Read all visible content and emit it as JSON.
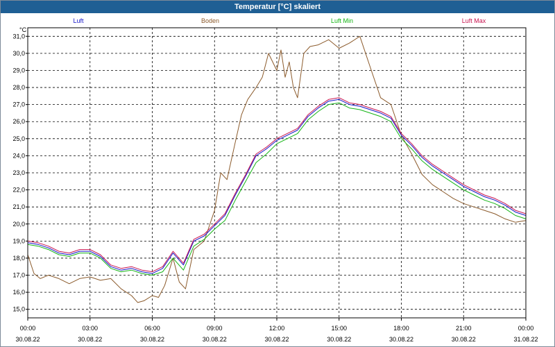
{
  "window": {
    "title": "Temperatur [°C] skaliert"
  },
  "colors": {
    "grid": "#000000",
    "frame_border": "#7d8a99",
    "titlebar": "#1f5f94"
  },
  "chart_data": {
    "type": "line",
    "ylabel": "°C",
    "xlabel": "",
    "ylim": [
      15.0,
      31.0
    ],
    "xlim": [
      "30.08.22 00:00",
      "31.08.22 00:00"
    ],
    "yticks": [
      "15,0",
      "16,0",
      "17,0",
      "18,0",
      "19,0",
      "20,0",
      "21,0",
      "22,0",
      "23,0",
      "24,0",
      "25,0",
      "26,0",
      "27,0",
      "28,0",
      "29,0",
      "30,0",
      "31,0"
    ],
    "xticks": [
      {
        "time": "00:00",
        "date": "30.08.22"
      },
      {
        "time": "03:00",
        "date": "30.08.22"
      },
      {
        "time": "06:00",
        "date": "30.08.22"
      },
      {
        "time": "09:00",
        "date": "30.08.22"
      },
      {
        "time": "12:00",
        "date": "30.08.22"
      },
      {
        "time": "15:00",
        "date": "30.08.22"
      },
      {
        "time": "18:00",
        "date": "30.08.22"
      },
      {
        "time": "21:00",
        "date": "30.08.22"
      },
      {
        "time": "00:00",
        "date": "31.08.22"
      }
    ],
    "grid": true,
    "legend_position": "top",
    "series": [
      {
        "name": "Luft",
        "color": "#1414c8",
        "x": [
          0,
          0.5,
          1,
          1.5,
          2,
          2.5,
          3,
          3.5,
          4,
          4.5,
          5,
          5.5,
          6,
          6.5,
          7,
          7.5,
          8,
          8.5,
          9,
          9.5,
          10,
          10.5,
          11,
          11.5,
          12,
          12.5,
          13,
          13.5,
          14,
          14.5,
          15,
          15.5,
          16,
          16.5,
          17,
          17.5,
          18,
          18.5,
          19,
          19.5,
          20,
          20.5,
          21,
          21.5,
          22,
          22.5,
          23,
          23.5,
          24
        ],
        "values": [
          18.9,
          18.8,
          18.6,
          18.3,
          18.2,
          18.4,
          18.4,
          18.1,
          17.5,
          17.3,
          17.4,
          17.2,
          17.1,
          17.4,
          18.3,
          17.6,
          19.0,
          19.3,
          19.9,
          20.5,
          21.7,
          22.8,
          24.0,
          24.4,
          24.9,
          25.2,
          25.5,
          26.3,
          26.8,
          27.2,
          27.3,
          27.0,
          26.9,
          26.7,
          26.5,
          26.2,
          25.2,
          24.6,
          23.9,
          23.4,
          23.0,
          22.6,
          22.2,
          21.9,
          21.6,
          21.4,
          21.1,
          20.7,
          20.5
        ]
      },
      {
        "name": "Boden",
        "color": "#8b5a2b",
        "x": [
          0,
          0.3,
          0.6,
          1,
          1.5,
          2,
          2.5,
          3,
          3.5,
          4,
          4.5,
          5,
          5.3,
          5.6,
          6,
          6.3,
          6.6,
          7,
          7.3,
          7.6,
          8,
          8.5,
          9,
          9.3,
          9.6,
          10,
          10.3,
          10.6,
          11,
          11.3,
          11.6,
          12,
          12.2,
          12.4,
          12.6,
          12.8,
          13,
          13.3,
          13.6,
          14,
          14.5,
          15,
          15.5,
          16,
          16.5,
          17,
          17.5,
          18,
          18.5,
          19,
          19.5,
          20,
          20.5,
          21,
          21.5,
          22,
          22.5,
          23,
          23.5,
          24
        ],
        "values": [
          18.2,
          17.1,
          16.8,
          17.0,
          16.8,
          16.5,
          16.8,
          16.9,
          16.7,
          16.8,
          16.2,
          15.8,
          15.4,
          15.5,
          15.8,
          15.7,
          16.4,
          18.0,
          16.6,
          16.2,
          18.5,
          19.0,
          20.8,
          23.0,
          22.6,
          24.8,
          26.4,
          27.3,
          28.0,
          28.6,
          30.0,
          29.0,
          30.2,
          28.6,
          29.5,
          28.0,
          27.4,
          30.0,
          30.4,
          30.5,
          30.8,
          30.3,
          30.6,
          31.0,
          29.2,
          27.4,
          27.0,
          25.2,
          24.1,
          22.9,
          22.3,
          21.9,
          21.5,
          21.2,
          21.0,
          20.8,
          20.6,
          20.3,
          20.1,
          20.2
        ]
      },
      {
        "name": "Luft Min",
        "color": "#14b414",
        "x": [
          0,
          0.5,
          1,
          1.5,
          2,
          2.5,
          3,
          3.5,
          4,
          4.5,
          5,
          5.5,
          6,
          6.5,
          7,
          7.5,
          8,
          8.5,
          9,
          9.5,
          10,
          10.5,
          11,
          11.5,
          12,
          12.5,
          13,
          13.5,
          14,
          14.5,
          15,
          15.5,
          16,
          16.5,
          17,
          17.5,
          18,
          18.5,
          19,
          19.5,
          20,
          20.5,
          21,
          21.5,
          22,
          22.5,
          23,
          23.5,
          24
        ],
        "values": [
          18.8,
          18.7,
          18.5,
          18.2,
          18.1,
          18.3,
          18.3,
          18.0,
          17.4,
          17.2,
          17.3,
          17.1,
          17.0,
          17.2,
          18.0,
          17.3,
          18.7,
          19.1,
          19.7,
          20.2,
          21.4,
          22.5,
          23.6,
          24.1,
          24.7,
          25.0,
          25.3,
          26.1,
          26.6,
          27.0,
          27.1,
          26.8,
          26.7,
          26.5,
          26.3,
          26.0,
          25.0,
          24.4,
          23.7,
          23.2,
          22.8,
          22.4,
          22.0,
          21.7,
          21.4,
          21.2,
          20.9,
          20.5,
          20.3
        ]
      },
      {
        "name": "Luft Max",
        "color": "#c81450",
        "x": [
          0,
          0.5,
          1,
          1.5,
          2,
          2.5,
          3,
          3.5,
          4,
          4.5,
          5,
          5.5,
          6,
          6.5,
          7,
          7.5,
          8,
          8.5,
          9,
          9.5,
          10,
          10.5,
          11,
          11.5,
          12,
          12.5,
          13,
          13.5,
          14,
          14.5,
          15,
          15.5,
          16,
          16.5,
          17,
          17.5,
          18,
          18.5,
          19,
          19.5,
          20,
          20.5,
          21,
          21.5,
          22,
          22.5,
          23,
          23.5,
          24
        ],
        "values": [
          19.0,
          18.9,
          18.7,
          18.4,
          18.3,
          18.5,
          18.5,
          18.2,
          17.6,
          17.4,
          17.5,
          17.3,
          17.2,
          17.5,
          18.4,
          17.7,
          19.1,
          19.4,
          20.0,
          20.6,
          21.8,
          22.9,
          24.1,
          24.5,
          25.0,
          25.3,
          25.6,
          26.4,
          26.9,
          27.3,
          27.4,
          27.1,
          27.0,
          26.8,
          26.6,
          26.3,
          25.3,
          24.7,
          24.0,
          23.5,
          23.1,
          22.7,
          22.3,
          22.0,
          21.7,
          21.5,
          21.2,
          20.8,
          20.6
        ]
      }
    ]
  }
}
